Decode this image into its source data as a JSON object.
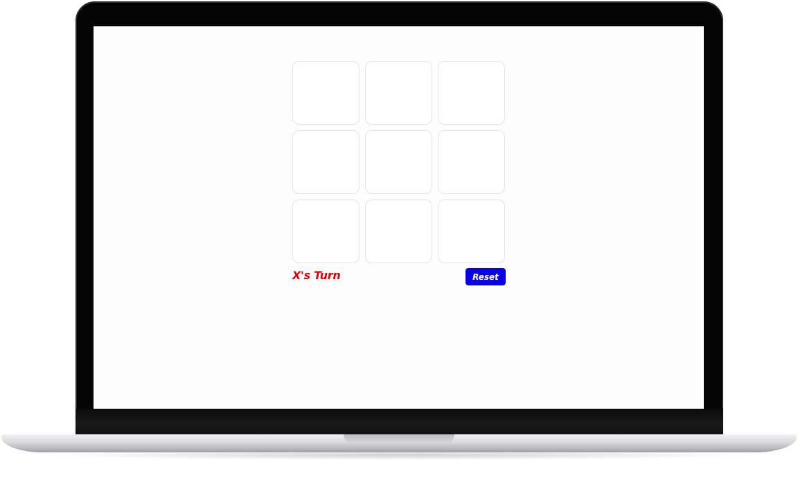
{
  "game": {
    "board": [
      "",
      "",
      "",
      "",
      "",
      "",
      "",
      "",
      ""
    ],
    "status": "X's Turn",
    "reset_label": "Reset"
  },
  "colors": {
    "status_text": "#e00000",
    "reset_button": "#0a00e6",
    "cell_border": "#e4e4e4",
    "screen_bg": "#fdfdfd",
    "bezel": "#050505"
  }
}
